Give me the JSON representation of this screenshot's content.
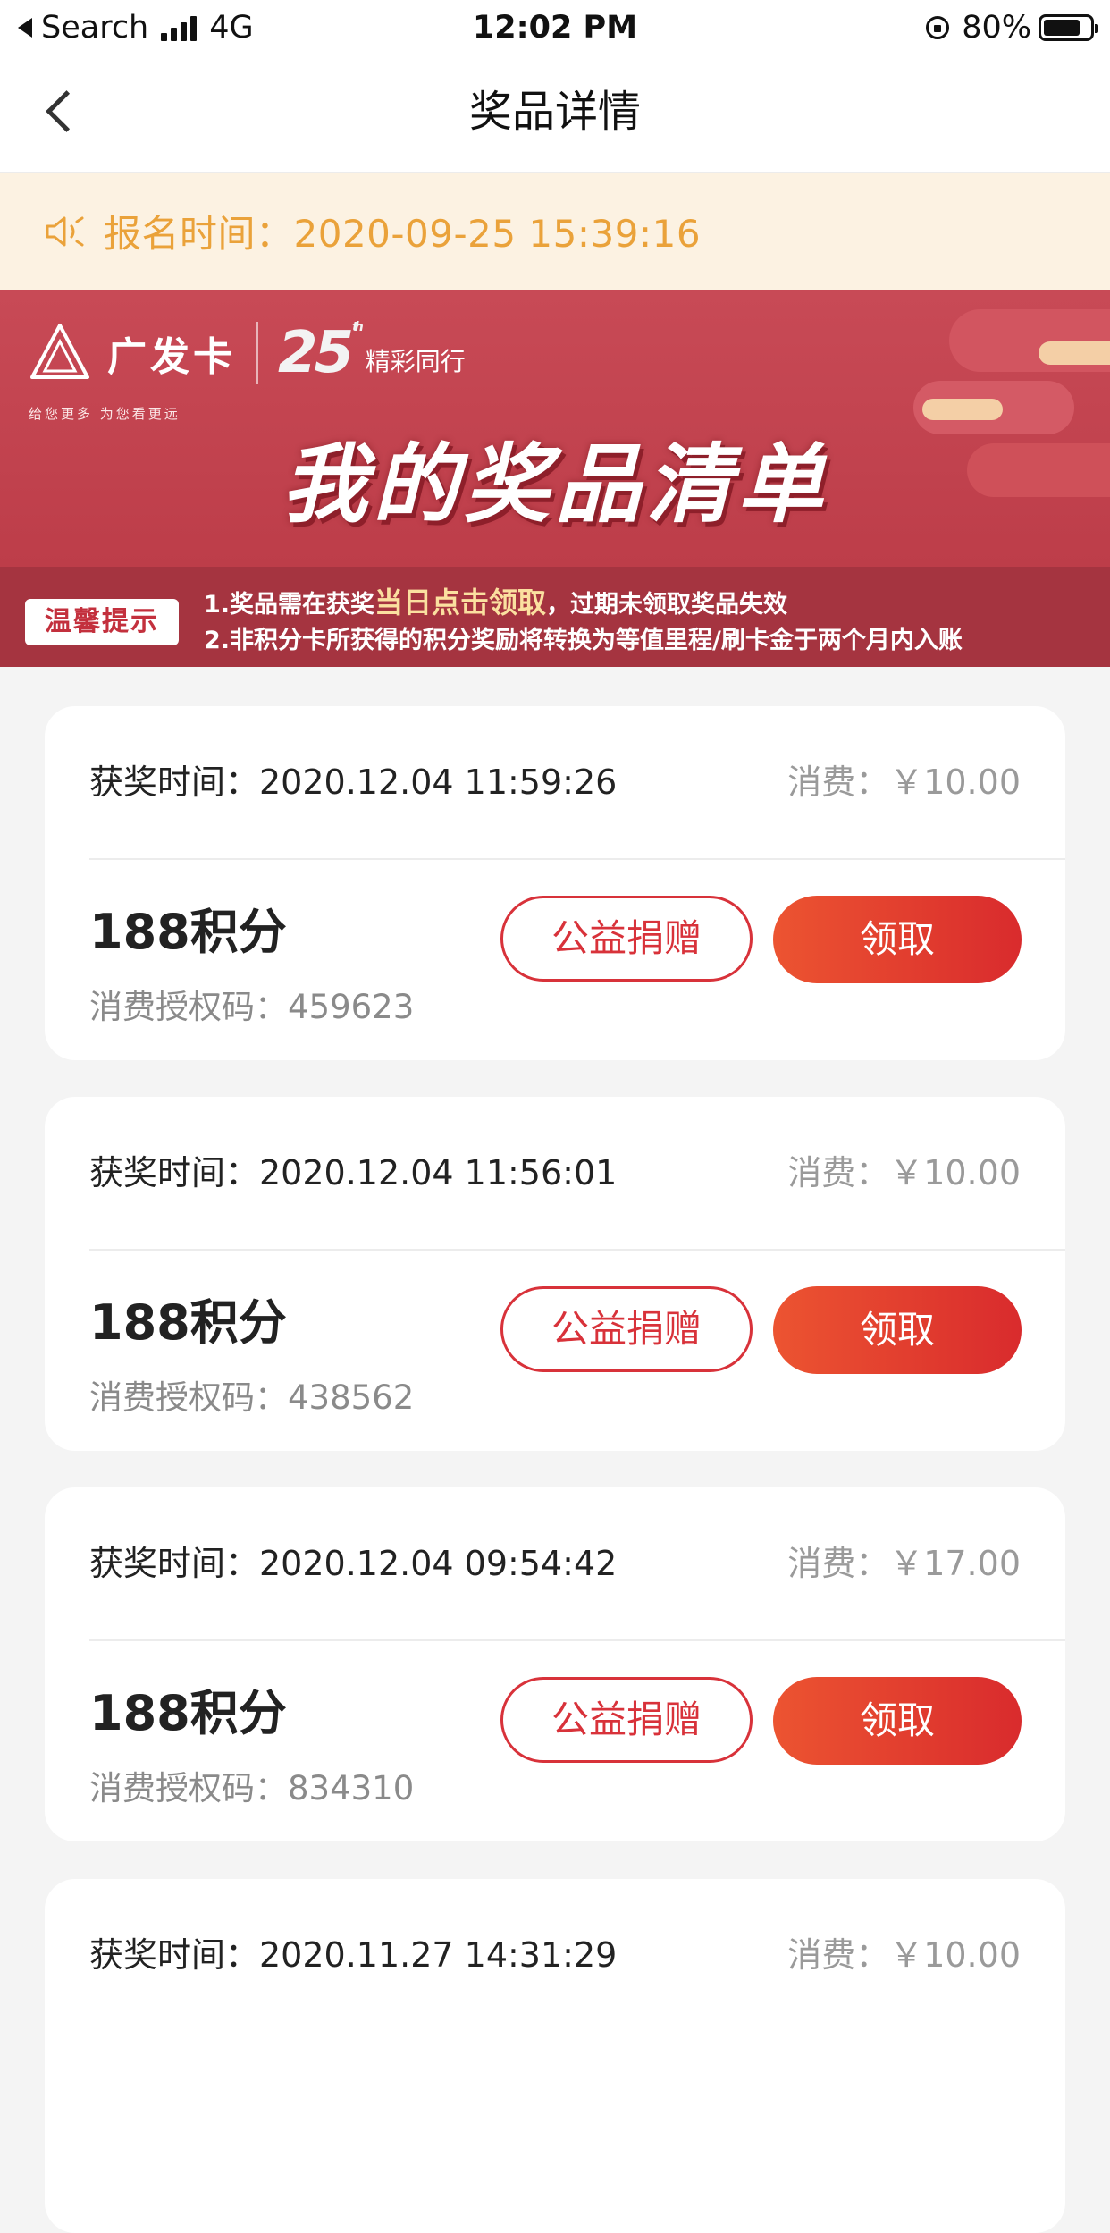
{
  "status_bar": {
    "back_app": "Search",
    "network": "4G",
    "time": "12:02 PM",
    "battery": "80%",
    "battery_level": 0.8
  },
  "nav": {
    "title": "奖品详情"
  },
  "notice": {
    "text": "报名时间：2020-09-25 15:39:16"
  },
  "banner": {
    "brand": "广发卡",
    "brand_sub": "给您更多  为您看更远",
    "anniversary": "25",
    "anniversary_suffix": "th",
    "slogan": "精彩同行",
    "title": "我的奖品清单",
    "tips_badge": "温馨提示",
    "tip1_prefix": "1.奖品需在获奖",
    "tip1_highlight": "当日点击领取",
    "tip1_suffix": "，过期未领取奖品失效",
    "tip2": "2.非积分卡所获得的积分奖励将转换为等值里程/刷卡金于两个月内入账"
  },
  "records": [
    {
      "time": "获奖时间：2020.12.04 11:59:26",
      "cost": "消费：￥10.00",
      "prize": "188积分",
      "code": "消费授权码：459623",
      "donate": "公益捐赠",
      "claim": "领取"
    },
    {
      "time": "获奖时间：2020.12.04 11:56:01",
      "cost": "消费：￥10.00",
      "prize": "188积分",
      "code": "消费授权码：438562",
      "donate": "公益捐赠",
      "claim": "领取"
    },
    {
      "time": "获奖时间：2020.12.04 09:54:42",
      "cost": "消费：￥17.00",
      "prize": "188积分",
      "code": "消费授权码：834310",
      "donate": "公益捐赠",
      "claim": "领取"
    },
    {
      "time": "获奖时间：2020.11.27 14:31:29",
      "cost": "消费：￥10.00",
      "prize": "",
      "code": "",
      "donate": "",
      "claim": ""
    }
  ],
  "colors": {
    "accent_red": "#d8323a",
    "notice_orange": "#eaa23a",
    "banner_red": "#c1444f"
  }
}
